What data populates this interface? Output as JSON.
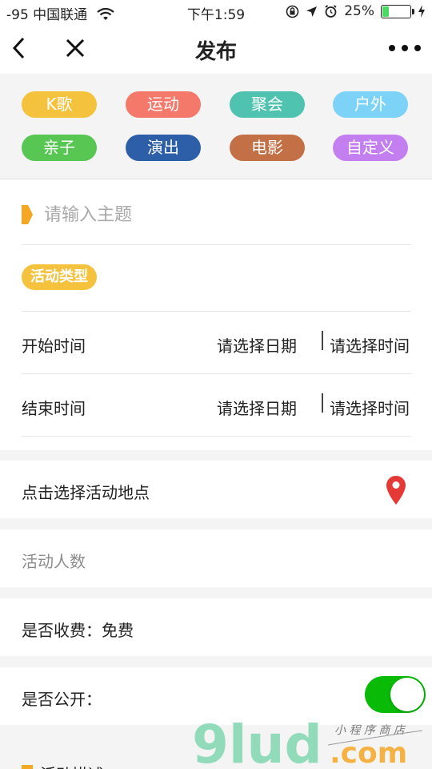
{
  "status_bar": {
    "carrier": "-95 中国联通",
    "time": "下午1:59",
    "battery_percent": "25%",
    "battery_level": 0.25
  },
  "nav": {
    "title": "发布"
  },
  "tags": [
    {
      "label": "K歌",
      "color": "#f5c23e"
    },
    {
      "label": "运动",
      "color": "#f4796a"
    },
    {
      "label": "聚会",
      "color": "#4fc3b0"
    },
    {
      "label": "户外",
      "color": "#7dd3f7"
    },
    {
      "label": "亲子",
      "color": "#57c653"
    },
    {
      "label": "演出",
      "color": "#2d5fa8"
    },
    {
      "label": "电影",
      "color": "#c47046"
    },
    {
      "label": "自定义",
      "color": "#c37ef0"
    }
  ],
  "form": {
    "topic_placeholder": "请输入主题",
    "activity_type_label": "活动类型",
    "start_time_label": "开始时间",
    "end_time_label": "结束时间",
    "date_placeholder": "请选择日期",
    "time_placeholder": "请选择时间",
    "location_label": "点击选择活动地点",
    "people_placeholder": "活动人数",
    "fee_label": "是否收费：",
    "fee_value": "免费",
    "public_label": "是否公开：",
    "public_on": true,
    "description_label": "活动描述"
  },
  "watermark": {
    "brand": "9lud",
    "domain": ".com",
    "tagline": "小程序商店"
  },
  "colors": {
    "accent": "#f5a623",
    "toggle_on": "#09bb07",
    "pin": "#e53935"
  }
}
